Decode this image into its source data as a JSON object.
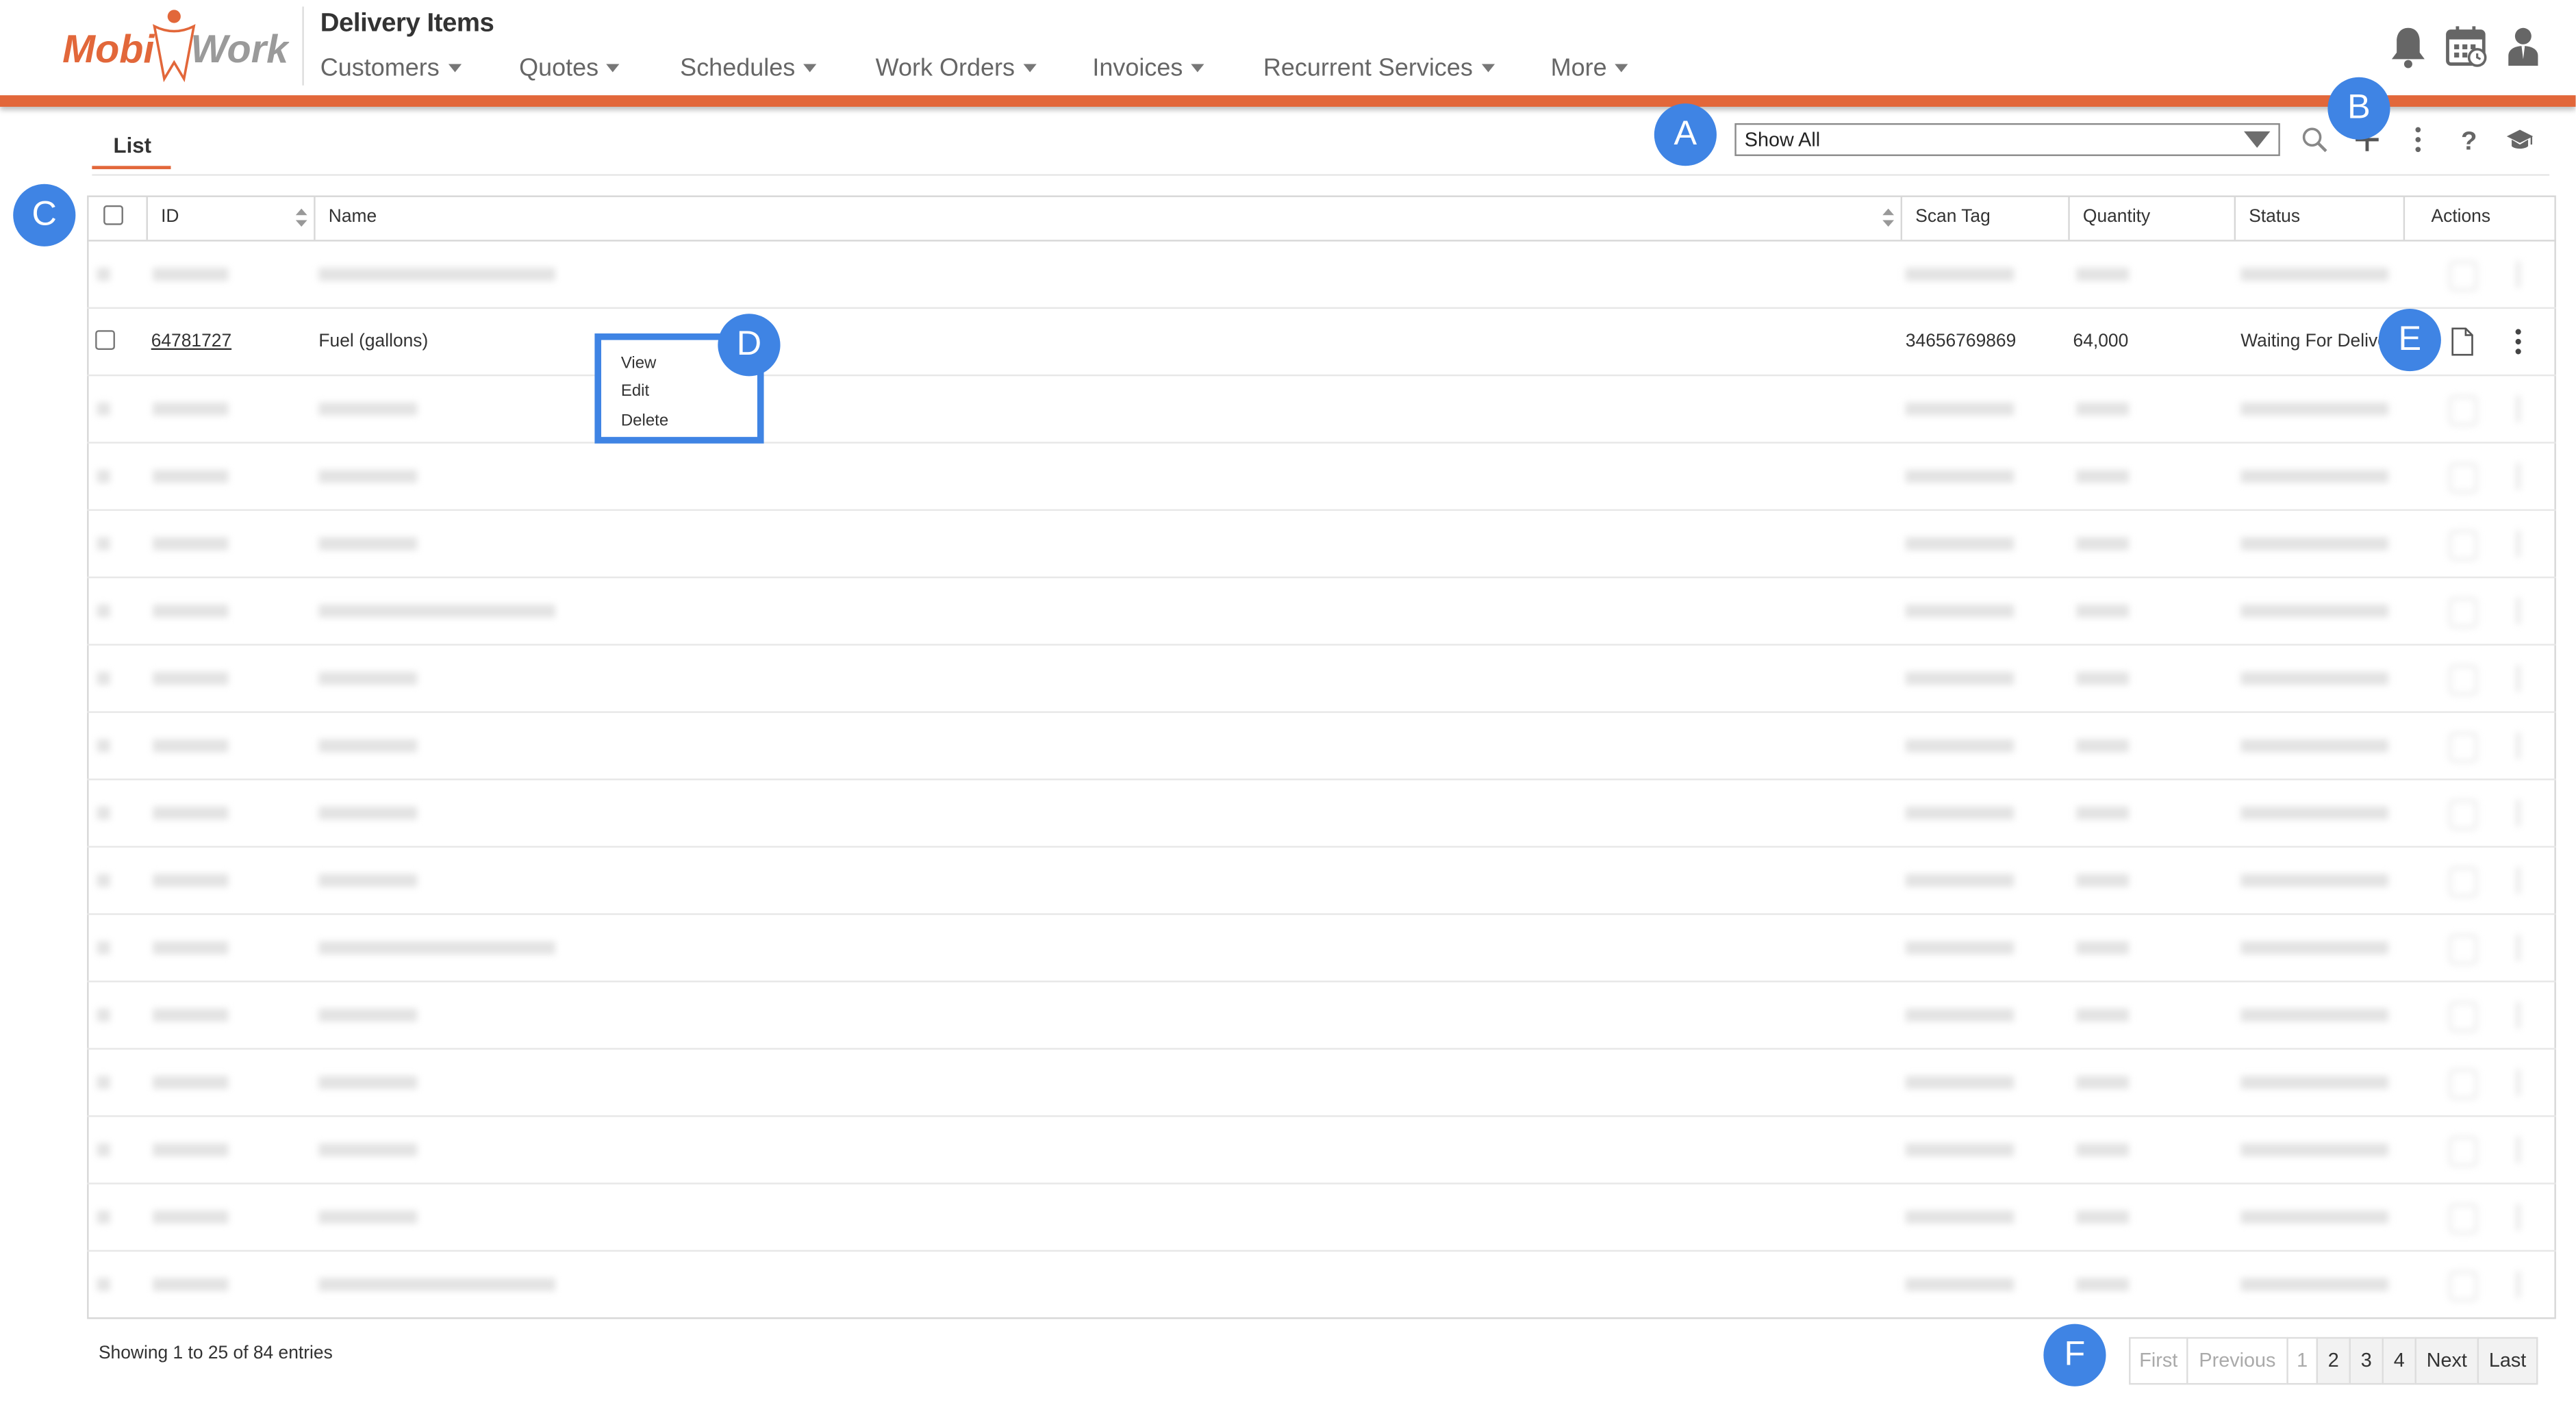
{
  "header": {
    "app_title": "Delivery Items",
    "logo_text_left": "Mobi",
    "logo_text_right": "Work",
    "nav": [
      "Customers",
      "Quotes",
      "Schedules",
      "Work Orders",
      "Invoices",
      "Recurrent Services",
      "More"
    ],
    "icons": [
      "bell-icon",
      "calendar-icon",
      "user-icon"
    ]
  },
  "toolbar": {
    "tab_label": "List",
    "filter_value": "Show All",
    "icons": [
      "search-icon",
      "plus-icon",
      "kebab-icon",
      "help-icon",
      "graduation-cap-icon"
    ]
  },
  "table": {
    "columns": [
      "ID",
      "Name",
      "Scan Tag",
      "Quantity",
      "Status",
      "Actions"
    ],
    "focused_row": {
      "id": "64781727",
      "name": "Fuel (gallons)",
      "scan_tag": "34656769869",
      "quantity": "64,000",
      "status": "Waiting For Delive"
    }
  },
  "context_menu": [
    "View",
    "Edit",
    "Delete"
  ],
  "callouts": [
    "A",
    "B",
    "C",
    "D",
    "E",
    "F"
  ],
  "footer": {
    "info": "Showing 1 to 25 of 84 entries",
    "pager": [
      "First",
      "Previous",
      "1",
      "2",
      "3",
      "4",
      "Next",
      "Last"
    ]
  },
  "colors": {
    "accent": "#e2673a",
    "callout": "#3f84e4",
    "border": "#d7d7d7"
  }
}
